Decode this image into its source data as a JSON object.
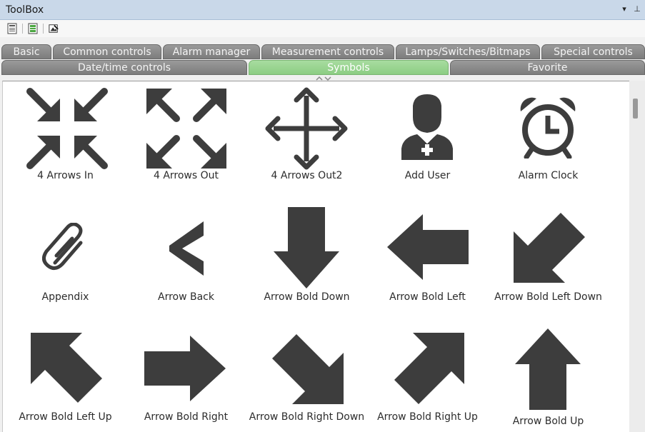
{
  "window": {
    "title": "ToolBox",
    "dropdown_glyph": "▾",
    "pin_glyph": "⊥"
  },
  "toolbar": {
    "icons": [
      "document-list-icon",
      "document-green-icon",
      "image-edit-icon"
    ]
  },
  "tabs_row1": [
    "Basic",
    "Common controls",
    "Alarm manager",
    "Measurement controls",
    "Lamps/Switches/Bitmaps",
    "Special controls"
  ],
  "tabs_row2": [
    "Date/time controls",
    "Symbols",
    "Favorite"
  ],
  "active_tab": "Symbols",
  "colors": {
    "icon": "#3d3d3d",
    "active_tab": "#8fd087",
    "tab": "#8a8a8a",
    "title_bar": "#c9d8e9"
  },
  "symbols": [
    {
      "label": "4 Arrows In",
      "icon": "four-arrows-in-icon"
    },
    {
      "label": "4 Arrows Out",
      "icon": "four-arrows-out-icon"
    },
    {
      "label": "4 Arrows Out2",
      "icon": "four-arrows-out2-icon"
    },
    {
      "label": "Add User",
      "icon": "add-user-icon"
    },
    {
      "label": "Alarm Clock",
      "icon": "alarm-clock-icon"
    },
    {
      "label": "Appendix",
      "icon": "paperclip-icon"
    },
    {
      "label": "Arrow Back",
      "icon": "arrow-back-icon"
    },
    {
      "label": "Arrow Bold Down",
      "icon": "arrow-bold-down-icon"
    },
    {
      "label": "Arrow Bold Left",
      "icon": "arrow-bold-left-icon"
    },
    {
      "label": "Arrow Bold Left Down",
      "icon": "arrow-bold-left-down-icon"
    },
    {
      "label": "Arrow Bold Left Up",
      "icon": "arrow-bold-left-up-icon"
    },
    {
      "label": "Arrow Bold Right",
      "icon": "arrow-bold-right-icon"
    },
    {
      "label": "Arrow Bold Right Down",
      "icon": "arrow-bold-right-down-icon"
    },
    {
      "label": "Arrow Bold Right Up",
      "icon": "arrow-bold-right-up-icon"
    },
    {
      "label": "Arrow Bold Up",
      "icon": "arrow-bold-up-icon"
    }
  ]
}
